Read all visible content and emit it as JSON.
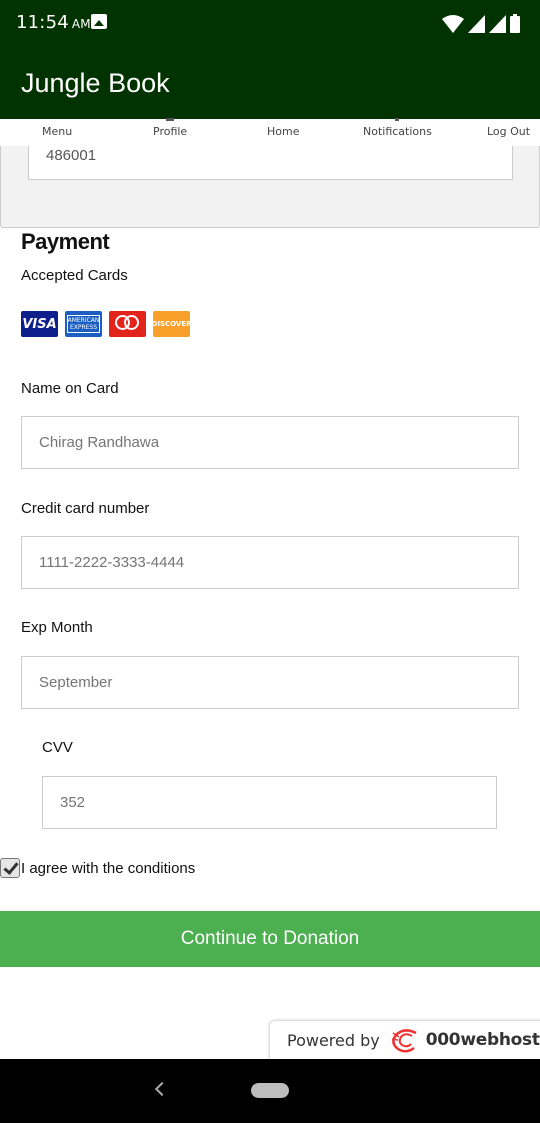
{
  "status_bar": {
    "time": "11:54",
    "ampm": "AM"
  },
  "app": {
    "title": "Jungle Book"
  },
  "nav": {
    "items": [
      "Menu",
      "Profile",
      "Home",
      "Notifications",
      "Log Out"
    ]
  },
  "address": {
    "pincode": "486001"
  },
  "payment": {
    "title": "Payment",
    "accepted_cards_label": "Accepted Cards",
    "cards": [
      "VISA",
      "AMERICAN EXPRESS",
      "mastercard",
      "DISCOVER"
    ]
  },
  "form": {
    "name_label": "Name on Card",
    "name_value": "Chirag Randhawa",
    "card_label": "Credit card number",
    "card_value": "1111-2222-3333-4444",
    "exp_label": "Exp Month",
    "exp_value": "September",
    "cvv_label": "CVV",
    "cvv_value": "352",
    "agree_label": "I agree with the conditions",
    "agree_checked": true
  },
  "continue_label": "Continue to Donation",
  "powered_by": {
    "text": "Powered by",
    "brand": "000webhost"
  },
  "colors": {
    "header": "#003300",
    "button": "#4caf50"
  }
}
